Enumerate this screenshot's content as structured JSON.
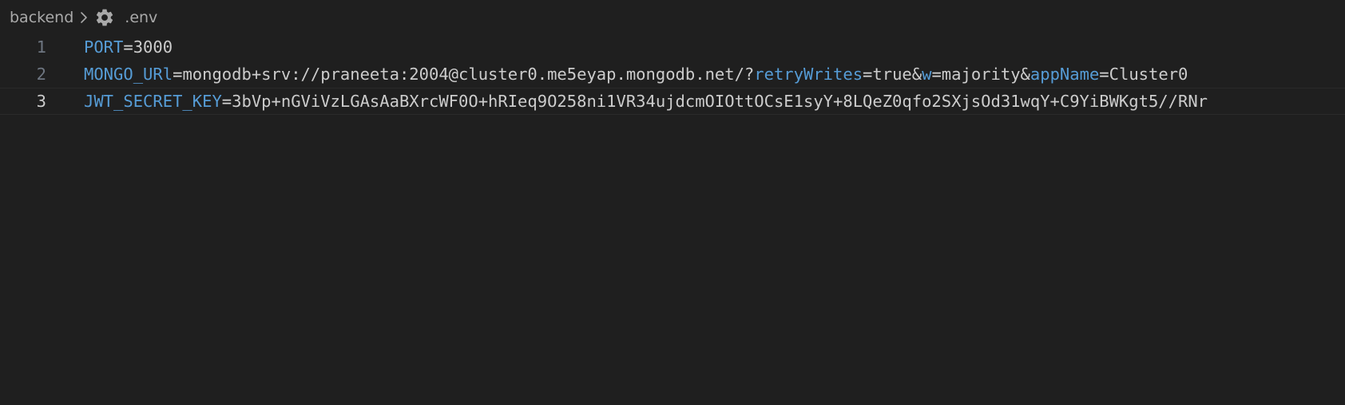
{
  "breadcrumb": {
    "folder": "backend",
    "separator_icon": "chevron-right-icon",
    "file_icon": "gear-icon",
    "file": ".env"
  },
  "lines": [
    {
      "number": "1",
      "tokens": [
        {
          "text": "PORT",
          "type": "key"
        },
        {
          "text": "=",
          "type": "op"
        },
        {
          "text": "3000",
          "type": "val"
        }
      ]
    },
    {
      "number": "2",
      "tokens": [
        {
          "text": "MONGO_URl",
          "type": "key"
        },
        {
          "text": "=",
          "type": "op"
        },
        {
          "text": "mongodb+srv://praneeta:2004@cluster0.me5eyap.mongodb.net/?",
          "type": "val"
        },
        {
          "text": "retryWrites",
          "type": "key"
        },
        {
          "text": "=",
          "type": "op"
        },
        {
          "text": "true&",
          "type": "val"
        },
        {
          "text": "w",
          "type": "key"
        },
        {
          "text": "=",
          "type": "op"
        },
        {
          "text": "majority&",
          "type": "val"
        },
        {
          "text": "appName",
          "type": "key"
        },
        {
          "text": "=",
          "type": "op"
        },
        {
          "text": "Cluster0",
          "type": "val"
        }
      ]
    },
    {
      "number": "3",
      "active": true,
      "tokens": [
        {
          "text": "JWT_SECRET_KEY",
          "type": "key"
        },
        {
          "text": "=",
          "type": "op"
        },
        {
          "text": "3bVp+nGViVzLGAsAaBXrcWF0O+hRIeq9O258ni1VR34ujdcmOIOttOCsE1syY+8LQeZ0qfo2SXjsOd31wqY+C9YiBWKgt5//RNr",
          "type": "val"
        }
      ]
    }
  ],
  "colors": {
    "background": "#1f1f1f",
    "key": "#569cd6",
    "value": "#cccccc",
    "line_number": "#6e7681"
  }
}
